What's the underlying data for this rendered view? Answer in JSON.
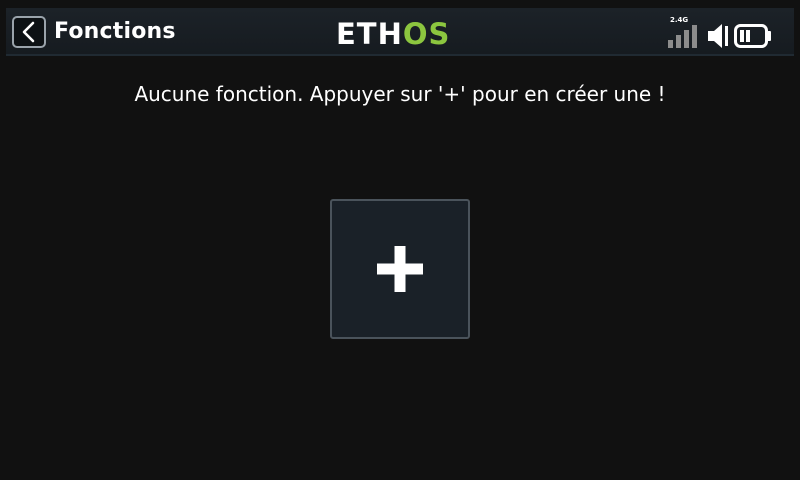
{
  "header": {
    "title": "Fonctions",
    "back_icon": "back-arrow-icon",
    "logo": {
      "part1": "ETH",
      "part2": "OS",
      "color_primary": "#ffffff",
      "color_accent": "#8cc63f"
    },
    "status": {
      "rf_band": "2.4G",
      "signal_bars": 4,
      "signal_icon": "signal-strength-icon",
      "volume_icon": "volume-icon",
      "battery_icon": "battery-icon",
      "battery_level_bars": 2
    }
  },
  "main": {
    "empty_message": "Aucune fonction. Appuyer sur '+' pour en créer une !",
    "add_button": {
      "icon": "plus-icon"
    }
  },
  "colors": {
    "background": "#111111",
    "header": "#1c2228",
    "button_fill": "#1a2128",
    "button_border": "#4a535b"
  }
}
